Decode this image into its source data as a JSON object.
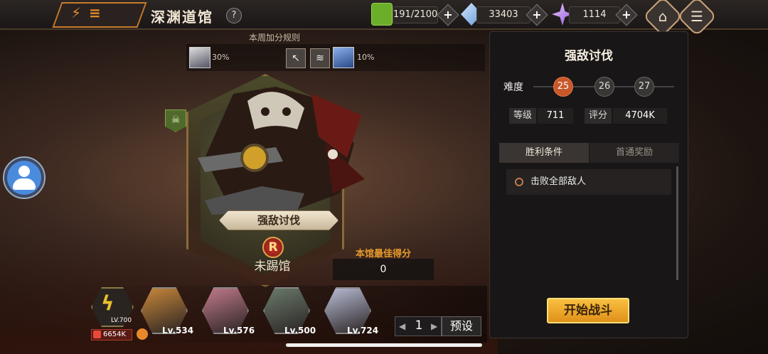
{
  "header": {
    "title": "深渊道馆",
    "help_label": "?",
    "resources": [
      {
        "name": "stamina",
        "value": "191/2100"
      },
      {
        "name": "crystal",
        "value": "33403"
      },
      {
        "name": "gem",
        "value": "1114"
      }
    ],
    "plus_label": "+",
    "home_icon": "home-icon",
    "menu_icon": "menu-icon"
  },
  "weekly_rule": {
    "title": "本周加分规则",
    "bonus_a": "30%",
    "bonus_b": "10%"
  },
  "boss": {
    "name": "强敌讨伐",
    "rank": "R",
    "status": "未踢馆",
    "best_score_label": "本馆最佳得分",
    "best_score": "0"
  },
  "team": {
    "leader_level": "LV.700",
    "power": "6654K",
    "heroes": [
      {
        "level": "Lv.534",
        "color": "#c8873a"
      },
      {
        "level": "Lv.576",
        "color": "#c07a8a"
      },
      {
        "level": "Lv.500",
        "color": "#6a7a6a"
      },
      {
        "level": "Lv.724",
        "color": "#b8bcd4"
      }
    ],
    "page": "1",
    "prev_label": "◀",
    "next_label": "▶",
    "preset_label": "预设"
  },
  "panel": {
    "title": "强敌讨伐",
    "difficulty_label": "难度",
    "difficulties": [
      "25",
      "26",
      "27"
    ],
    "level_label": "等级",
    "level_value": "711",
    "score_label": "评分",
    "score_value": "4704K",
    "tab_win": "胜利条件",
    "tab_reward": "首通奖励",
    "condition": "击败全部敌人",
    "start_label": "开始战斗"
  },
  "colors": {
    "accent": "#e0901a",
    "active_difficulty": "#c8582a"
  }
}
